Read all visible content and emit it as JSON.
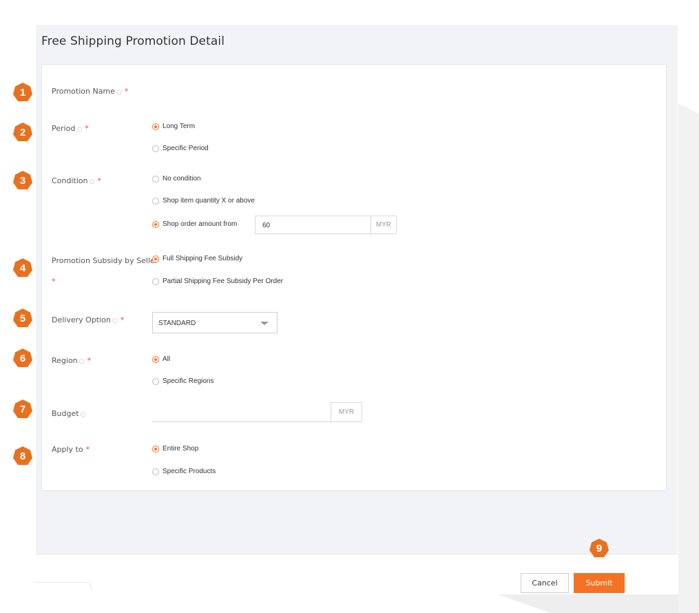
{
  "page": {
    "title": "Free Shipping Promotion Detail"
  },
  "colors": {
    "accent": "#f57224",
    "badge": "#e8711f",
    "required": "#f0462c"
  },
  "fields": {
    "promotion_name": {
      "label": "Promotion Name",
      "badge": "1"
    },
    "period": {
      "label": "Period",
      "badge": "2",
      "options": [
        "Long Term",
        "Specific Period"
      ],
      "selected": "Long Term"
    },
    "condition": {
      "label": "Condition",
      "badge": "3",
      "options": [
        "No condition",
        "Shop item quantity X or above",
        "Shop order amount from"
      ],
      "selected": "Shop order amount from",
      "amount_value": "60",
      "amount_unit": "MYR"
    },
    "subsidy": {
      "label": "Promotion Subsidy by Seller",
      "badge": "4",
      "options": [
        "Full Shipping Fee Subsidy",
        "Partial Shipping Fee Subsidy Per Order"
      ],
      "selected": "Full Shipping Fee Subsidy"
    },
    "delivery": {
      "label": "Delivery Option",
      "badge": "5",
      "value": "STANDARD"
    },
    "region": {
      "label": "Region",
      "badge": "6",
      "options": [
        "All",
        "Specific Regions"
      ],
      "selected": "All"
    },
    "budget": {
      "label": "Budget",
      "badge": "7",
      "value": "",
      "unit": "MYR"
    },
    "apply_to": {
      "label": "Apply to",
      "badge": "8",
      "options": [
        "Entire Shop",
        "Specific Products"
      ],
      "selected": "Entire Shop"
    }
  },
  "footer": {
    "cancel_label": "Cancel",
    "submit_label": "Submit",
    "submit_badge": "9"
  },
  "symbols": {
    "required": "*",
    "hint": "○"
  }
}
